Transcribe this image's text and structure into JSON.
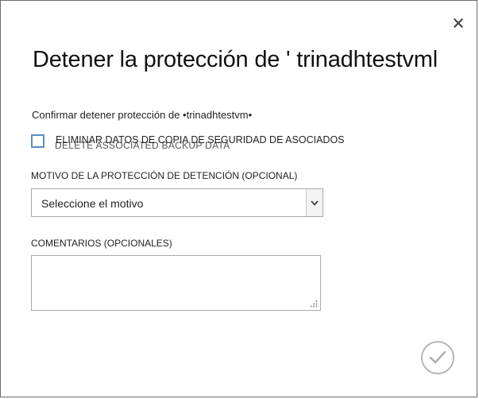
{
  "dialog": {
    "title": "Detener la protección de ' trinadhtestvml",
    "confirm_text": "Confirmar detener protección de •trinadhtestvm•",
    "checkbox": {
      "label": "ELIMINAR DATOS DE COPIA DE SEGURIDAD DE ASOCIADOS",
      "ghost_label": "DELETE ASSOCIATED BACKUP DATA",
      "checked": false
    },
    "reason": {
      "label": "MOTIVO DE LA PROTECCIÓN DE DETENCIÓN (OPCIONAL)",
      "selected": "Seleccione el motivo"
    },
    "comments": {
      "label": "COMENTARIOS (OPCIONALES)",
      "value": ""
    }
  },
  "icons": {
    "close": "close-icon",
    "dropdown": "chevron-down-icon",
    "ok": "checkmark-icon",
    "grip": "resize-grip-icon"
  },
  "colors": {
    "checkbox_border": "#5a8fc4",
    "border": "#a9a9a9",
    "ok_circle": "#b5b5b5"
  }
}
